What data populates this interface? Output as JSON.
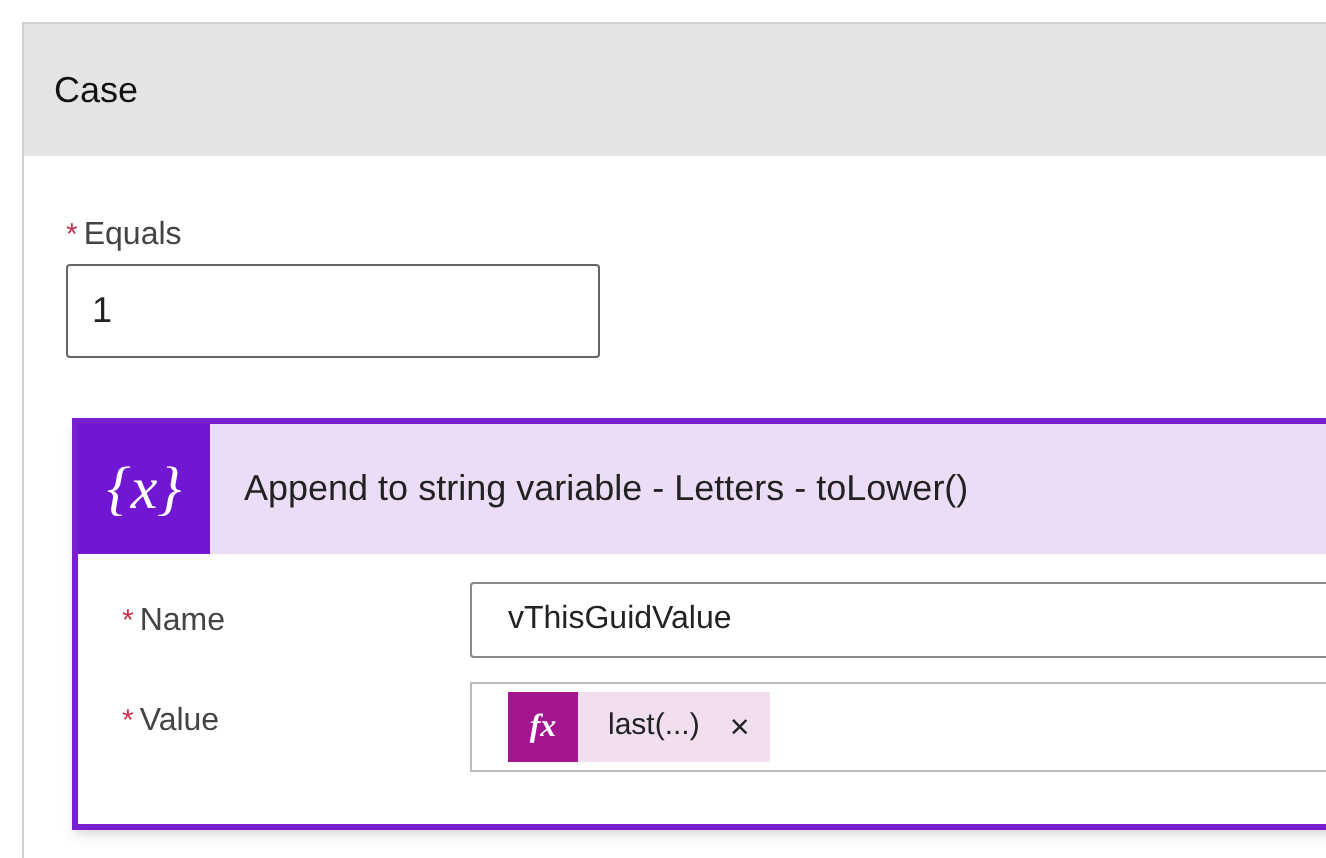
{
  "case": {
    "title": "Case"
  },
  "equals": {
    "label": "Equals",
    "required_mark": "*",
    "value": "1"
  },
  "action": {
    "icon_glyph": "{x}",
    "title": "Append to string variable - Letters - toLower()",
    "fields": [
      {
        "kind": "text",
        "label": "Name",
        "required_mark": "*",
        "value": "vThisGuidValue"
      },
      {
        "kind": "token",
        "label": "Value",
        "required_mark": "*",
        "token": {
          "glyph": "fx",
          "text": "last(...)",
          "remove": "×"
        }
      }
    ]
  }
}
